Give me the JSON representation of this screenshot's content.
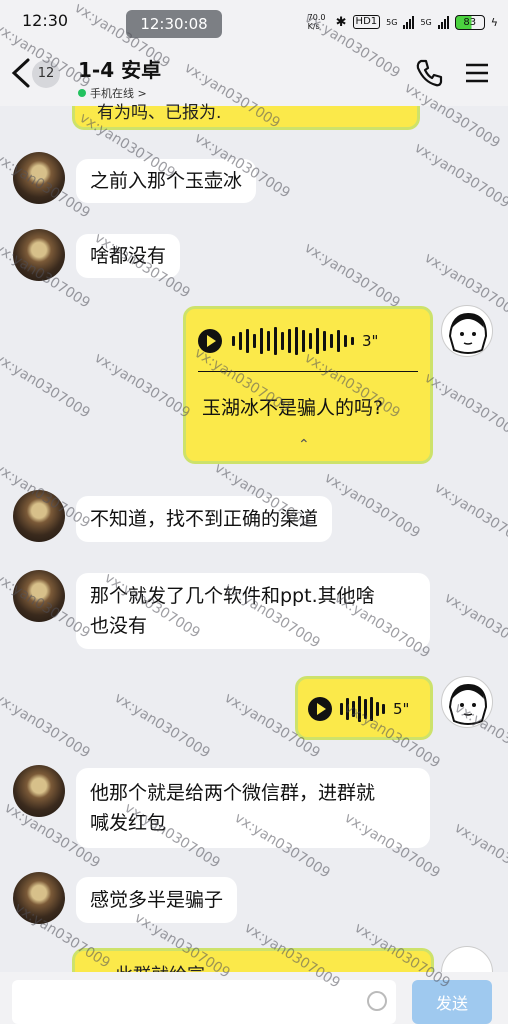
{
  "status_bar": {
    "time": "12:30",
    "overlay_time": "12:30:08",
    "hd_label": "HD1",
    "network_5g_a": "5G",
    "network_5g_b": "5G",
    "battery": "83",
    "speed_label": "70.0 K/s"
  },
  "header": {
    "unread_count": "12",
    "title": "1-4 安卓",
    "status": "手机在线 >"
  },
  "messages": {
    "m0_partial": "有为吗、已报为.",
    "m1": "之前入那个玉壶冰",
    "m2": "啥都没有",
    "voice1_duration": "3\"",
    "voice1_transcript": "玉湖冰不是骗人的吗?",
    "m3": "不知道，找不到正确的渠道",
    "m4_line1": "那个就发了几个软件和ppt.其他啥",
    "m4_line2": "也没有",
    "voice2_duration": "5\"",
    "m5_line1": "他那个就是给两个微信群，进群就",
    "m5_line2": "喊发红包",
    "m6": "感觉多半是骗子",
    "m7_partial": "此群就给宣"
  },
  "input": {
    "placeholder": "",
    "send_label": "发送"
  },
  "watermark_text": "vx:yan0307009",
  "colors": {
    "background": "#ecedf1",
    "yellow_bubble": "#fbe94a",
    "send_button": "#9fc9ef",
    "online": "#23c25f"
  }
}
